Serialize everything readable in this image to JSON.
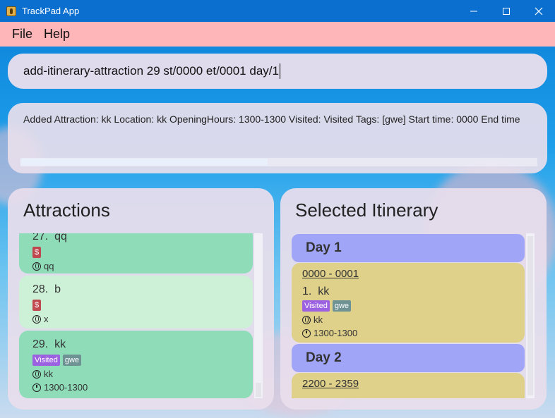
{
  "window": {
    "title": "TrackPad App",
    "controls": [
      "minimize",
      "maximize",
      "close"
    ]
  },
  "menu": {
    "file": "File",
    "help": "Help"
  },
  "command": {
    "value": "add-itinerary-attraction 29 st/0000 et/0001 day/1"
  },
  "result": {
    "text": "Added Attraction: kk Location: kk OpeningHours: 1300-1300 Visited: Visited Tags: [gwe] Start time: 0000 End time"
  },
  "attractions": {
    "title": "Attractions",
    "items": [
      {
        "index": "27.",
        "name": "qq",
        "tags": [
          "$"
        ],
        "location": "qq"
      },
      {
        "index": "28.",
        "name": "b",
        "tags": [
          "$"
        ],
        "location": "x"
      },
      {
        "index": "29.",
        "name": "kk",
        "tags": [
          "Visited",
          "gwe"
        ],
        "location": "kk",
        "hours": "1300-1300"
      }
    ]
  },
  "itinerary": {
    "title": "Selected Itinerary",
    "days": [
      {
        "label": "Day 1",
        "entries": [
          {
            "time": "0000 - 0001",
            "index": "1.",
            "name": "kk",
            "tags": [
              "Visited",
              "gwe"
            ],
            "location": "kk",
            "hours": "1300-1300"
          }
        ]
      },
      {
        "label": "Day 2",
        "entries": [
          {
            "time": "2200 - 2359"
          }
        ]
      }
    ]
  },
  "colors": {
    "menubar": "#ffb6b9",
    "titlebar": "#0a6fcf",
    "attraction_card": "#8fdcb9",
    "attraction_card_selected": "#cdf1d7",
    "day_header": "#a0a5f7",
    "itinerary_card": "#dfd08a",
    "tag_price": "#c0494f",
    "tag_visited": "#9c61e0",
    "tag_plain": "#6f9394"
  }
}
